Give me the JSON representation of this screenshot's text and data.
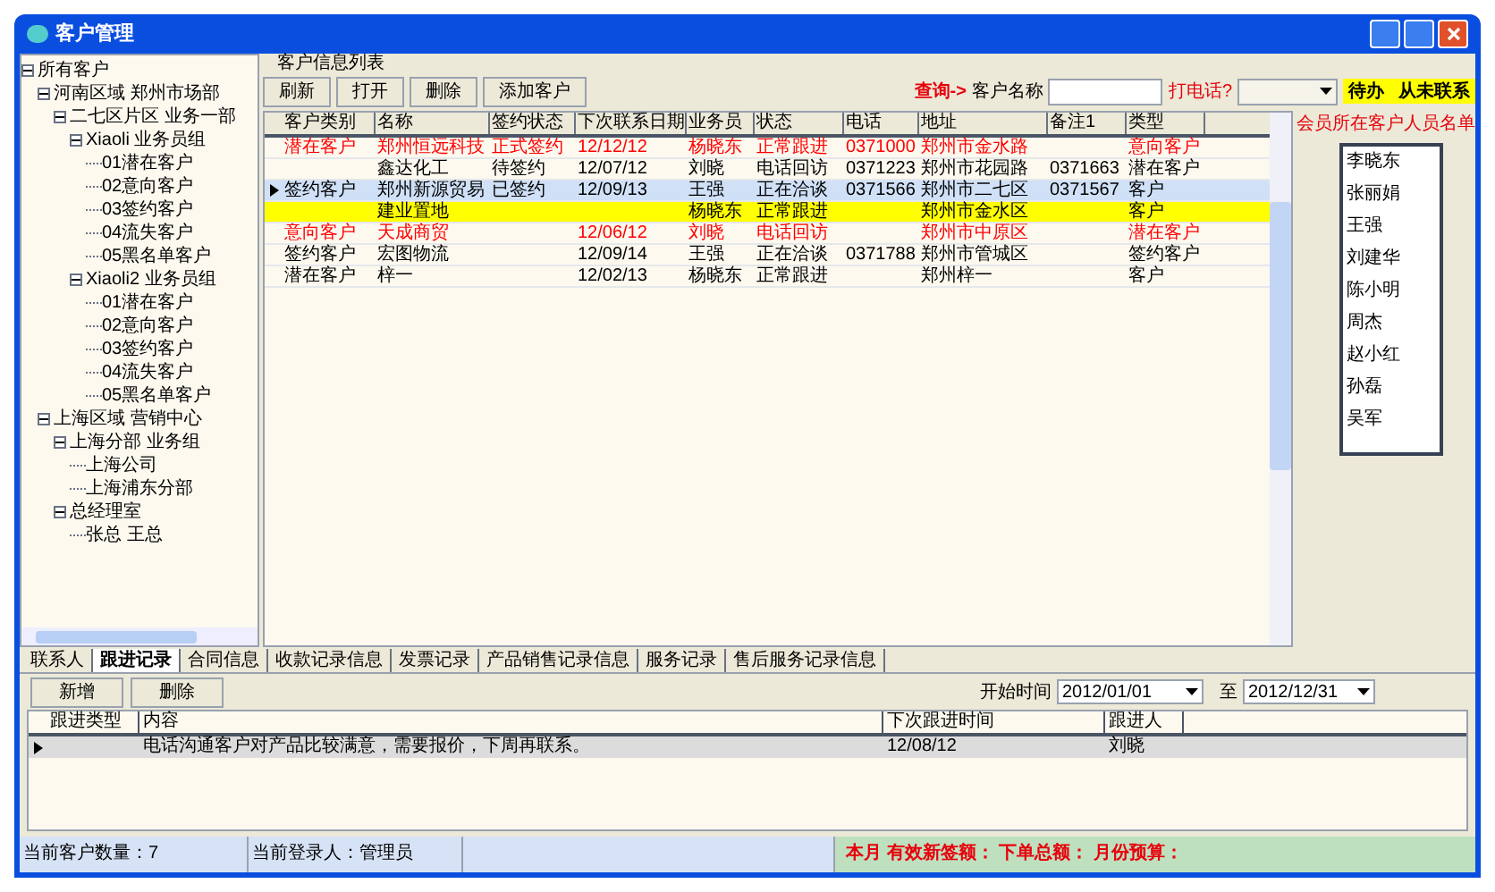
{
  "window": {
    "title": "客户管理"
  },
  "tree": [
    {
      "label": "所有客户",
      "expanded": true,
      "children": [
        {
          "label": "河南区域 郑州市场部",
          "expanded": true,
          "children": [
            {
              "label": "二七区片区 业务一部",
              "expanded": true,
              "children": [
                {
                  "label": "Xiaoli 业务员组",
                  "expanded": true,
                  "children": [
                    {
                      "label": "01潜在客户"
                    },
                    {
                      "label": "02意向客户"
                    },
                    {
                      "label": "03签约客户"
                    },
                    {
                      "label": "04流失客户"
                    },
                    {
                      "label": "05黑名单客户"
                    }
                  ]
                },
                {
                  "label": "Xiaoli2 业务员组",
                  "expanded": true,
                  "children": [
                    {
                      "label": "01潜在客户"
                    },
                    {
                      "label": "02意向客户"
                    },
                    {
                      "label": "03签约客户"
                    },
                    {
                      "label": "04流失客户"
                    },
                    {
                      "label": "05黑名单客户"
                    }
                  ]
                }
              ]
            }
          ]
        },
        {
          "label": "上海区域 营销中心",
          "expanded": true,
          "children": [
            {
              "label": "上海分部 业务组",
              "expanded": true,
              "children": [
                {
                  "label": "上海公司"
                },
                {
                  "label": "上海浦东分部"
                }
              ]
            },
            {
              "label": "总经理室",
              "expanded": true,
              "children": [
                {
                  "label": "张总 王总"
                }
              ]
            }
          ]
        }
      ]
    }
  ],
  "list_group": {
    "title": "客户信息列表"
  },
  "toolbar": {
    "buttons": [
      "刷新",
      "打开",
      "删除",
      "添加客户"
    ]
  },
  "search": {
    "label_prefix": "查询->",
    "label": "客户名称",
    "phone_label": "打电话?"
  },
  "flags": [
    "待办",
    "从未联系"
  ],
  "table": {
    "columns": [
      "客户类别",
      "名称",
      "签约状态",
      "下次联系日期",
      "业务员",
      "状态",
      "电话",
      "地址",
      "备注1",
      "类型"
    ],
    "rows": [
      {
        "selected": false,
        "highlighted": false,
        "alert": true,
        "cells": [
          "潜在客户",
          "郑州恒远科技",
          "正式签约",
          "12/12/12",
          "杨晓东",
          "正常跟进",
          "0371000",
          "郑州市金水路",
          "",
          "意向客户"
        ]
      },
      {
        "selected": false,
        "highlighted": false,
        "alert": false,
        "cells": [
          "",
          "鑫达化工",
          "待签约",
          "12/07/12",
          "刘晓",
          "电话回访",
          "0371223",
          "郑州市花园路",
          "0371663",
          "潜在客户"
        ]
      },
      {
        "selected": true,
        "highlighted": false,
        "alert": false,
        "cells": [
          "签约客户",
          "郑州新源贸易",
          "已签约",
          "12/09/13",
          "王强",
          "正在洽谈",
          "0371566",
          "郑州市二七区",
          "0371567",
          "客户"
        ]
      },
      {
        "selected": false,
        "highlighted": true,
        "alert": false,
        "cells": [
          "",
          "建业置地",
          "",
          "",
          "杨晓东",
          "正常跟进",
          "",
          "郑州市金水区",
          "",
          "客户"
        ]
      },
      {
        "selected": false,
        "highlighted": false,
        "alert": true,
        "cells": [
          "意向客户",
          "天成商贸",
          "",
          "12/06/12",
          "刘晓",
          "电话回访",
          "",
          "郑州市中原区",
          "",
          "潜在客户"
        ]
      },
      {
        "selected": false,
        "highlighted": false,
        "alert": false,
        "cells": [
          "签约客户",
          "宏图物流",
          "",
          "12/09/14",
          "王强",
          "正在洽谈",
          "0371788",
          "郑州市管城区",
          "",
          "签约客户"
        ]
      },
      {
        "selected": false,
        "highlighted": false,
        "alert": false,
        "cells": [
          "潜在客户",
          "梓一",
          "",
          "12/02/13",
          "杨晓东",
          "正常跟进",
          "",
          "郑州梓一",
          "",
          "客户"
        ]
      }
    ]
  },
  "staff_panel": {
    "title": "会员所在客户人员名单",
    "items": [
      "李晓东",
      "张丽娟",
      "王强",
      "刘建华",
      "陈小明",
      "周杰",
      "赵小红",
      "孙磊",
      "吴军"
    ]
  },
  "bottom_tabs": [
    {
      "label": "联系人",
      "selected": false
    },
    {
      "label": "跟进记录",
      "selected": true
    },
    {
      "label": "合同信息",
      "selected": false
    },
    {
      "label": "收款记录信息",
      "selected": false
    },
    {
      "label": "发票记录",
      "selected": false
    },
    {
      "label": "产品销售记录信息",
      "selected": false
    },
    {
      "label": "服务记录",
      "selected": false
    },
    {
      "label": "售后服务记录信息",
      "selected": false
    }
  ],
  "bottom_buttons": [
    "新增",
    "删除"
  ],
  "date_filter": {
    "start_label": "开始时间",
    "start_value": "2012/01/01",
    "end_label": "至",
    "end_value": "2012/12/31"
  },
  "followup_table": {
    "columns": [
      "跟进类型",
      "内容",
      "下次跟进时间",
      "跟进人"
    ],
    "rows": [
      {
        "selected": true,
        "cells": [
          "",
          "电话沟通客户对产品比较满意，需要报价，下周再联系。",
          "12/08/12",
          "刘晓"
        ]
      }
    ]
  },
  "status_bar": {
    "left": "当前客户数量：7",
    "middle": "当前登录人：管理员",
    "summary": "本月 有效新签额： 下单总额： 月份预算："
  }
}
